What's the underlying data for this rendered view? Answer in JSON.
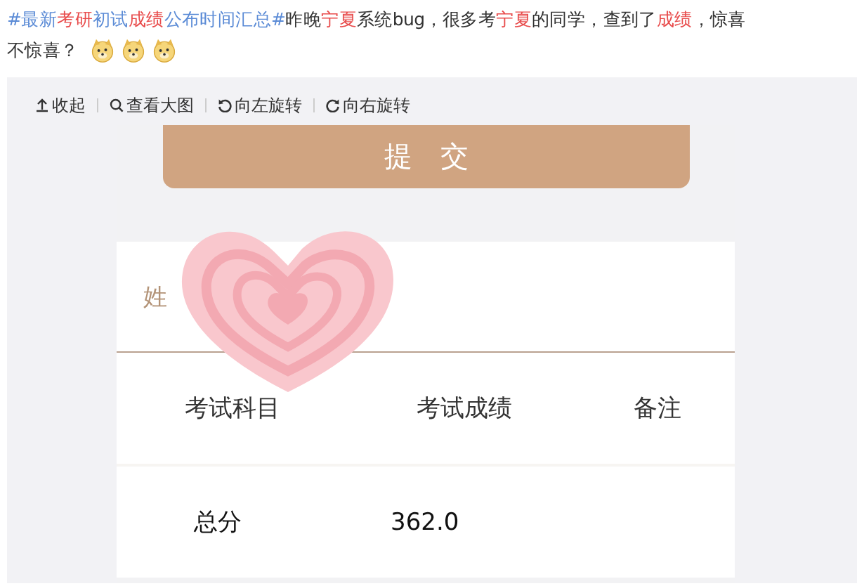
{
  "post": {
    "lines": [
      [
        {
          "kind": "topic",
          "text": "#最新"
        },
        {
          "kind": "highlight",
          "text": "考研"
        },
        {
          "kind": "topic",
          "text": "初试"
        },
        {
          "kind": "highlight",
          "text": "成绩"
        },
        {
          "kind": "topic",
          "text": "公布时间汇总#"
        },
        {
          "kind": "plain",
          "text": "昨晚"
        },
        {
          "kind": "highlight",
          "text": "宁夏"
        },
        {
          "kind": "plain",
          "text": "系统bug，很多考"
        },
        {
          "kind": "highlight",
          "text": "宁夏"
        },
        {
          "kind": "plain",
          "text": "的同学，查到了"
        },
        {
          "kind": "highlight",
          "text": "成绩"
        },
        {
          "kind": "plain",
          "text": "，惊喜"
        }
      ],
      [
        {
          "kind": "plain",
          "text": "不惊喜？"
        }
      ]
    ]
  },
  "image_toolbar": [
    {
      "kind": "collapse",
      "label": "收起"
    },
    {
      "kind": "zoom",
      "label": "查看大图"
    },
    {
      "kind": "rotate_left",
      "label": "向左旋转"
    },
    {
      "kind": "rotate_right",
      "label": "向右旋转"
    }
  ],
  "screenshot": {
    "submit_button": "提　交",
    "name_label": "姓",
    "table": {
      "columns": [
        "考试科目",
        "考试成绩",
        "备注"
      ],
      "rows": [
        [
          "总分",
          "362.0",
          ""
        ]
      ]
    }
  }
}
